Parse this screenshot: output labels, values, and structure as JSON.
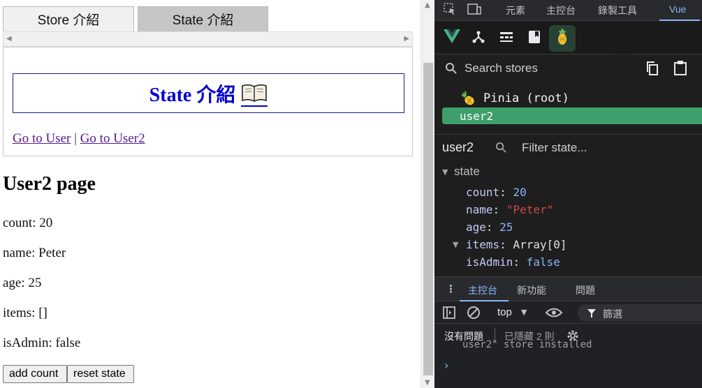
{
  "tabs": [
    {
      "label": "Store 介紹"
    },
    {
      "label": "State 介紹"
    }
  ],
  "iframe": {
    "title": "State 介紹",
    "link_user": "Go to User",
    "separator": "|",
    "link_user2": "Go to User2"
  },
  "page": {
    "heading": "User2 page",
    "count_line": "count: 20",
    "name_line": "name: Peter",
    "age_line": "age: 25",
    "items_line": "items: []",
    "admin_line": "isAdmin: false",
    "add_count": "add count",
    "reset_state": "reset state"
  },
  "devtools": {
    "tabs": [
      "元素",
      "主控台",
      "錄製工具",
      "Vue"
    ],
    "search_stores": "Search stores",
    "stores": [
      {
        "label": "Pinia (root)"
      },
      {
        "label": "user2"
      }
    ],
    "selected_store": "user2",
    "filter_placeholder": "Filter state...",
    "state_section": "state",
    "state": {
      "count_key": "count",
      "count_val": "20",
      "name_key": "name",
      "name_val": "\"Peter\"",
      "age_key": "age",
      "age_val": "25",
      "items_key": "items",
      "items_val": "Array[0]",
      "admin_key": "isAdmin",
      "admin_val": "false"
    },
    "drawer_tabs": [
      "主控台",
      "新功能",
      "問題"
    ],
    "context": "top",
    "filter_label": "篩選",
    "no_issues": "沒有問題",
    "hidden_issues": "已隱藏 2 則",
    "log_line": "user2\" store installed",
    "prompt": "›"
  },
  "colors": {
    "title_blue": "#0000cd",
    "vue_green": "#3f9f6a",
    "devtools_bg": "#202124",
    "accent_blue": "#8ab4f8"
  }
}
